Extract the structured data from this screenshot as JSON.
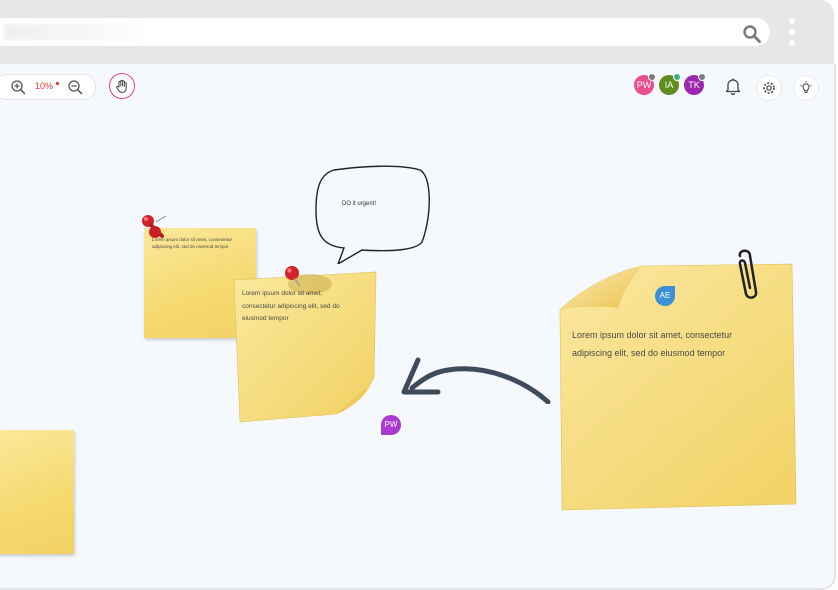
{
  "toolbar": {
    "zoom_level": "10%",
    "zoom_in_icon": "zoom-in-icon",
    "zoom_out_icon": "zoom-out-icon",
    "hand_tool_icon": "hand-icon"
  },
  "collaborators": [
    {
      "initials": "PW",
      "color": "#e84f8c",
      "status_color": "#7a7a7a"
    },
    {
      "initials": "IA",
      "color": "#5e8f1e",
      "status_color": "#3fb37f"
    },
    {
      "initials": "TK",
      "color": "#9c27b0",
      "status_color": "#7a7a7a"
    }
  ],
  "header_icons": [
    "bell-icon",
    "settings-icon",
    "lightbulb-icon"
  ],
  "speech_bubble": {
    "text": "DO it urgent!"
  },
  "notes": {
    "small_pinned": {
      "text": "Lorem ipsum dolor sit amet, consectetur adipiscing elit, sed do eiusmod tempor"
    },
    "medium_pinned": {
      "text": "Lorem ipsum dolor sit amet, consectetur adipiscing elit, sed do eiusmod tempor"
    },
    "large_clipped": {
      "text": "Lorem ipsum dolor sit amet, consectetur adipiscing elit, sed do eiusmod tempor"
    }
  },
  "cursors": [
    {
      "initials": "AE",
      "color": "#3d8fd6"
    },
    {
      "initials": "PW",
      "color": "#a93ad6"
    }
  ],
  "colors": {
    "note_yellow": "#f5d96f",
    "accent_pink": "#e6457a",
    "arrow": "#3f4a5a"
  }
}
